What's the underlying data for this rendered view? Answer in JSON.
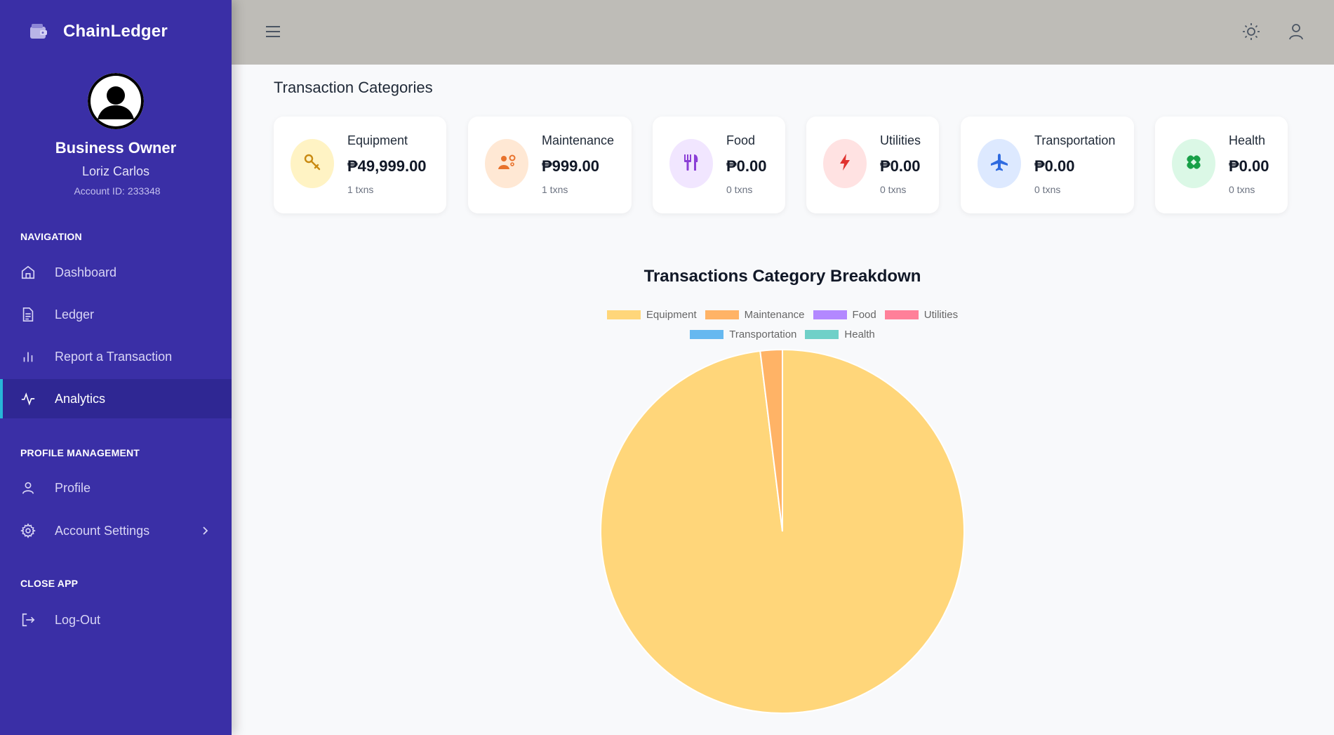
{
  "app": {
    "name": "ChainLedger",
    "role": "Business Owner",
    "user_name": "Loriz Carlos",
    "account_label": "Account ID:",
    "account_id": "233348"
  },
  "sidebar": {
    "sections": {
      "navigation": "NAVIGATION",
      "profile": "PROFILE MANAGEMENT",
      "close": "CLOSE APP"
    },
    "items": [
      {
        "label": "Dashboard",
        "icon": "home-icon"
      },
      {
        "label": "Ledger",
        "icon": "document-icon"
      },
      {
        "label": "Report a Transaction",
        "icon": "bar-chart-icon"
      },
      {
        "label": "Analytics",
        "icon": "pulse-icon",
        "active": true
      },
      {
        "label": "Profile",
        "icon": "user-icon"
      },
      {
        "label": "Account Settings",
        "icon": "gear-icon"
      },
      {
        "label": "Log-Out",
        "icon": "logout-icon"
      }
    ]
  },
  "main": {
    "title": "Transaction Categories",
    "categories": [
      {
        "name": "Equipment",
        "amount": "₱49,999.00",
        "txns": "1 txns",
        "icon": "wrench-icon",
        "bg": "#fff3c4",
        "fg": "#c98a12"
      },
      {
        "name": "Maintenance",
        "amount": "₱999.00",
        "txns": "1 txns",
        "icon": "worker-gear-icon",
        "bg": "#ffe8d4",
        "fg": "#e8722c"
      },
      {
        "name": "Food",
        "amount": "₱0.00",
        "txns": "0 txns",
        "icon": "utensils-icon",
        "bg": "#f1e6ff",
        "fg": "#8b3fd6"
      },
      {
        "name": "Utilities",
        "amount": "₱0.00",
        "txns": "0 txns",
        "icon": "bolt-icon",
        "bg": "#ffe2e2",
        "fg": "#e0322f"
      },
      {
        "name": "Transportation",
        "amount": "₱0.00",
        "txns": "0 txns",
        "icon": "plane-icon",
        "bg": "#dde9ff",
        "fg": "#2f6be0"
      },
      {
        "name": "Health",
        "amount": "₱0.00",
        "txns": "0 txns",
        "icon": "bandage-icon",
        "bg": "#dbf8e6",
        "fg": "#18a048"
      }
    ]
  },
  "chart_data": {
    "type": "pie",
    "title": "Transactions Category Breakdown",
    "categories": [
      "Equipment",
      "Maintenance",
      "Food",
      "Utilities",
      "Transportation",
      "Health"
    ],
    "values": [
      49999,
      999,
      0,
      0,
      0,
      0
    ],
    "colors": [
      "#ffd67a",
      "#ffb366",
      "#b388ff",
      "#ff8099",
      "#66b8f0",
      "#6fd0c8"
    ],
    "legend_position": "top"
  }
}
